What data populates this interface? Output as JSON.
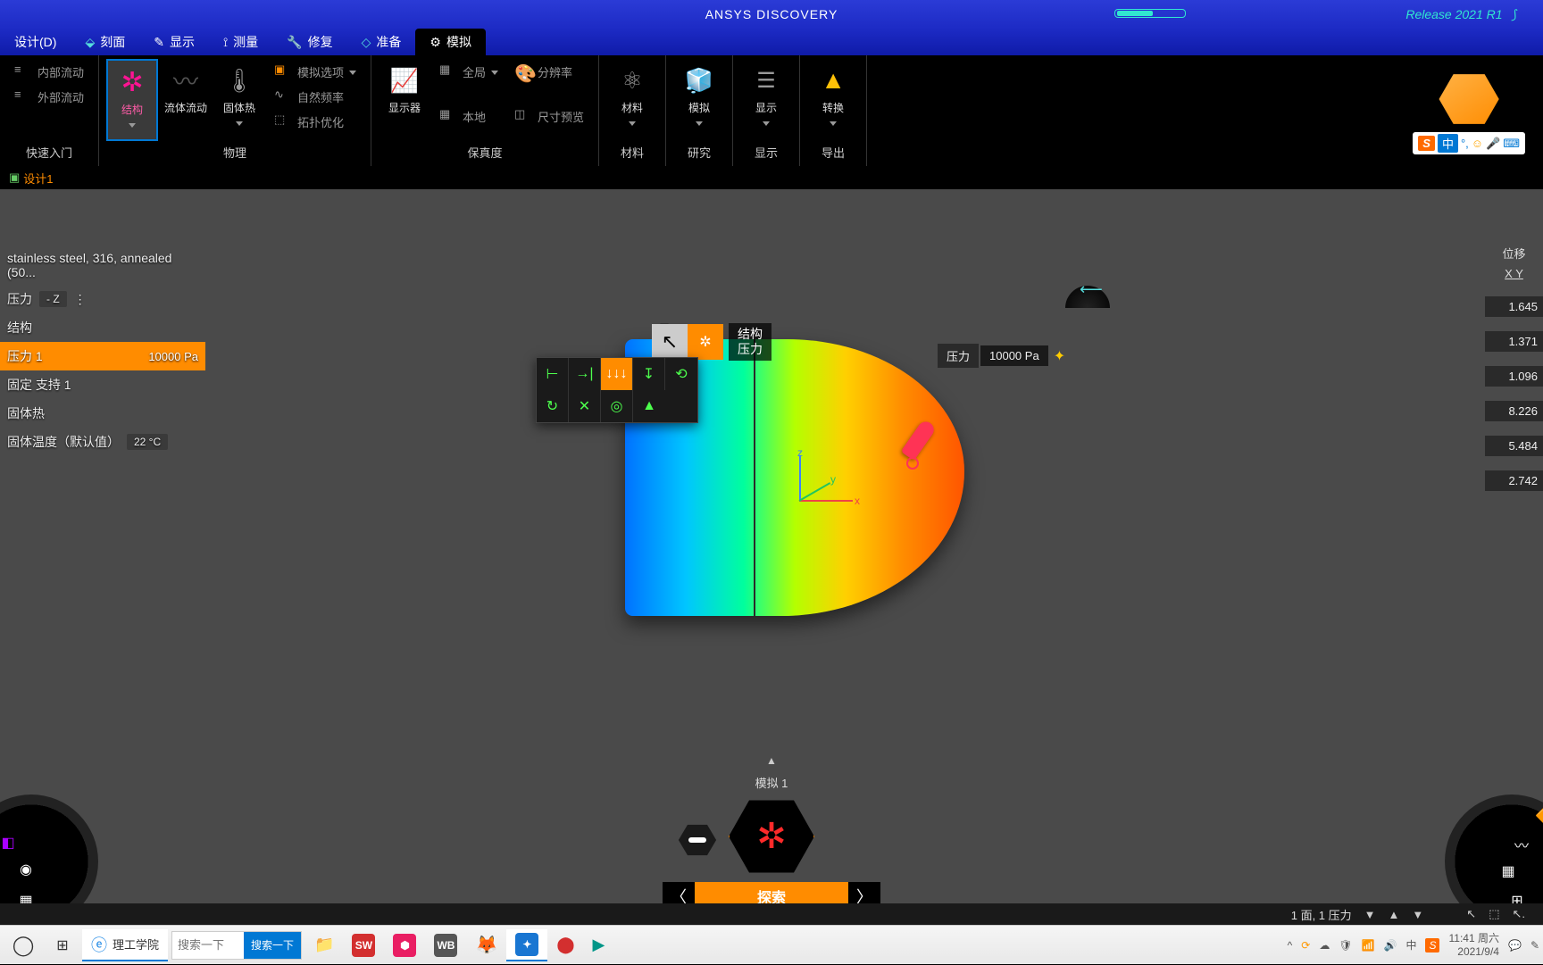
{
  "title": "ANSYS DISCOVERY",
  "release": "Release 2021 R1",
  "tabs": {
    "design": "设计(D)",
    "profile": "刻面",
    "display": "显示",
    "measure": "测量",
    "repair": "修复",
    "prepare": "准备",
    "simulate": "模拟"
  },
  "ribbon": {
    "groups": {
      "quick": "快速入门",
      "physics": "物理",
      "fidelity": "保真度",
      "material": "材料",
      "research": "研究",
      "display": "显示",
      "export": "导出"
    },
    "items": {
      "internal_flow": "内部流动",
      "external_flow": "外部流动",
      "structure": "结构",
      "fluid_flow": "流体流动",
      "solid_heat": "固体热",
      "sim_options": "模拟选项",
      "natural_freq": "自然频率",
      "topo_opt": "拓扑优化",
      "monitor": "显示器",
      "global": "全局",
      "local": "本地",
      "resolution": "分辨率",
      "size_preview": "尺寸预览",
      "material": "材料",
      "simulate": "模拟",
      "show": "显示",
      "convert": "转换"
    }
  },
  "doc_tab": "设计1",
  "tree": {
    "material": "stainless steel, 316, annealed (50...",
    "force": "压力",
    "force_dir": "- Z",
    "struct": "结构",
    "pressure1": "压力 1",
    "pressure1_val": "10000 Pa",
    "fixed": "固定 支持 1",
    "body_heat": "固体热",
    "body_temp": "固体温度（默认值）",
    "body_temp_val": "22 °C"
  },
  "ctx_label": {
    "l1": "结构",
    "l2": "压力"
  },
  "pressure_tag": {
    "label": "压力",
    "value": "10000 Pa"
  },
  "legend": {
    "header": "位移",
    "axis": "X   Y",
    "vals": [
      "1.645",
      "1.371",
      "1.096",
      "8.226",
      "5.484",
      "2.742"
    ]
  },
  "stage": {
    "sim_label": "模拟 1",
    "explore": "探索"
  },
  "status": {
    "selection": "1 面, 1 压力"
  },
  "taskbar": {
    "browser_title": "理工学院",
    "search_btn": "搜索一下",
    "ime": "中",
    "time": "11:41",
    "day": "周六",
    "date": "2021/9/4"
  }
}
